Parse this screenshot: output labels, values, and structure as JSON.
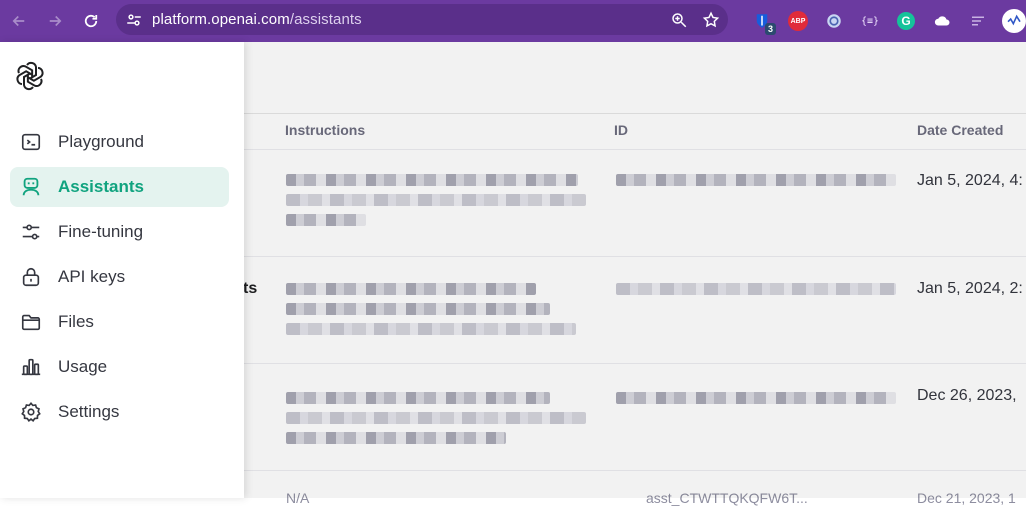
{
  "browser": {
    "url_host": "platform.openai.com",
    "url_path": "/assistants",
    "extensions": [
      {
        "name": "bitwarden-icon",
        "badge": "3"
      },
      {
        "name": "adblock-icon",
        "label": "ABP"
      },
      {
        "name": "circle-extension-icon"
      },
      {
        "name": "json-extension-icon",
        "label": "{≡}"
      },
      {
        "name": "grammarly-icon",
        "label": "G"
      },
      {
        "name": "cloud-extension-icon"
      },
      {
        "name": "list-extension-icon"
      },
      {
        "name": "profile-avatar-icon"
      }
    ]
  },
  "sidebar": {
    "items": [
      {
        "label": "Playground",
        "icon": "terminal-icon",
        "active": false
      },
      {
        "label": "Assistants",
        "icon": "robot-icon",
        "active": true
      },
      {
        "label": "Fine-tuning",
        "icon": "sliders-icon",
        "active": false
      },
      {
        "label": "API keys",
        "icon": "lock-icon",
        "active": false
      },
      {
        "label": "Files",
        "icon": "folder-icon",
        "active": false
      },
      {
        "label": "Usage",
        "icon": "bar-chart-icon",
        "active": false
      },
      {
        "label": "Settings",
        "icon": "gear-icon",
        "active": false
      }
    ]
  },
  "table": {
    "columns": {
      "instructions": "Instructions",
      "id": "ID",
      "date_created": "Date Created"
    },
    "rows": [
      {
        "name_fragment": "",
        "date": "Jan 5, 2024, 4:"
      },
      {
        "name_fragment": "ts",
        "date": "Jan 5, 2024, 2:"
      },
      {
        "name_fragment": "",
        "date": "Dec 26, 2023,"
      }
    ],
    "partial_row": {
      "instructions": "N/A",
      "id": "asst_CTWTTQKQFW6T...",
      "date": "Dec 21, 2023, 1"
    }
  },
  "colors": {
    "chrome": "#6b3aa0",
    "accent": "#10a37f",
    "active_bg": "#e4f3ef"
  }
}
